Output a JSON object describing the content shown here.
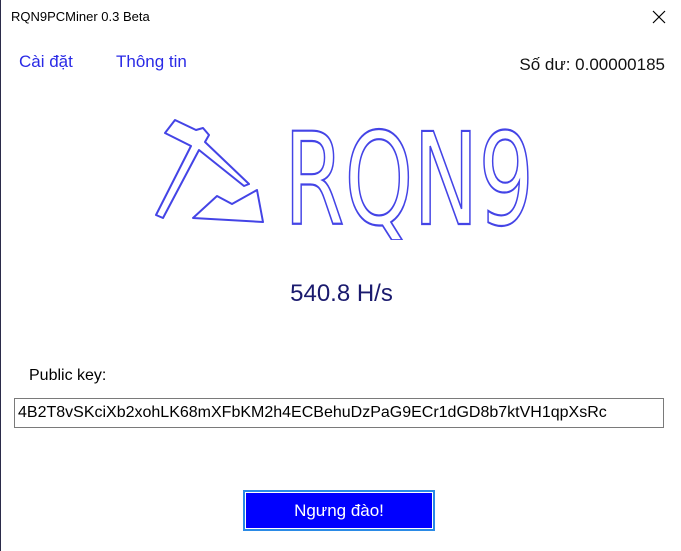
{
  "window": {
    "title": "RQN9PCMiner 0.3 Beta"
  },
  "menu": {
    "settings": "Cài đặt",
    "about": "Thông tin"
  },
  "balance": "Số dư: 0.00000185",
  "logo": {
    "text": "RQN9",
    "color": "#4444e6"
  },
  "hashrate": "540.8 H/s",
  "public_key": {
    "label": "Public key:",
    "value": "4B2T8vSKciXb2xohLK68mXFbKM2h4ECBehuDzPaG9ECr1dGD8b7ktVH1qpXsRc"
  },
  "stop_button": "Ngưng đào!"
}
